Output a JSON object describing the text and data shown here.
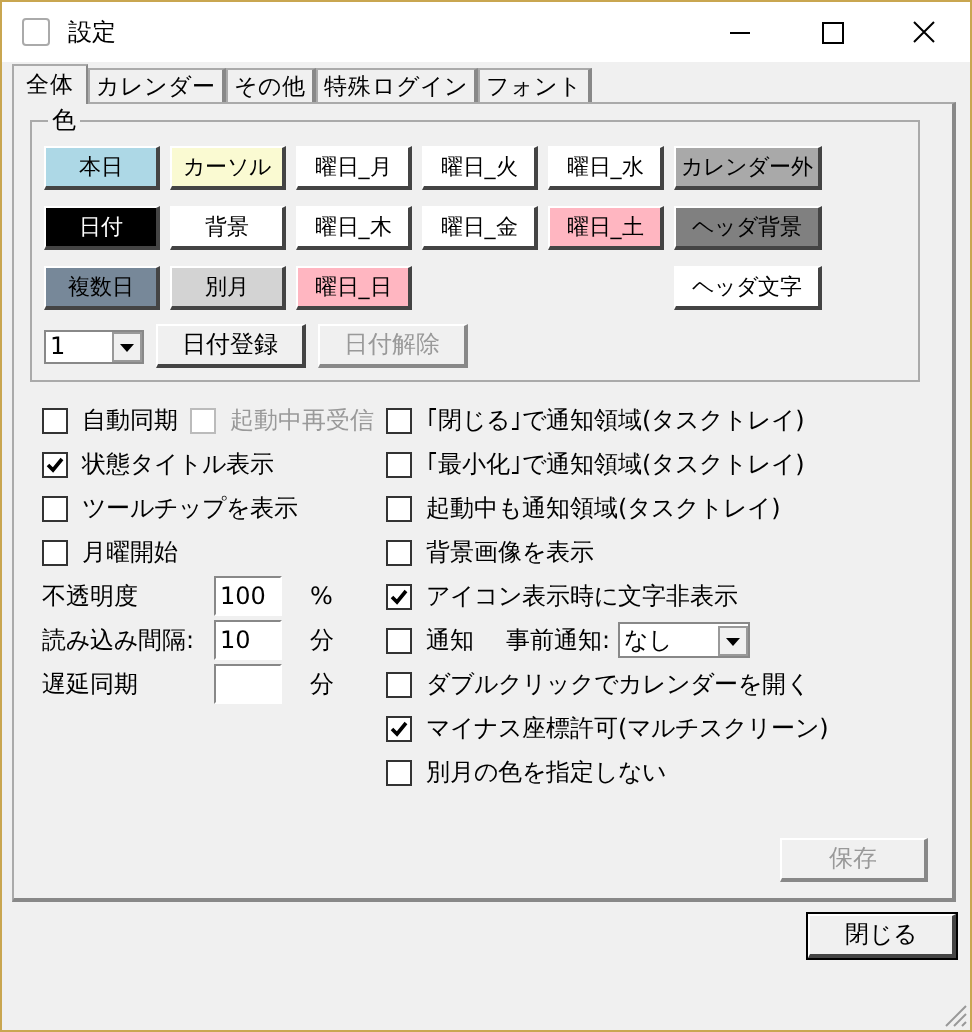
{
  "window": {
    "title": "設定"
  },
  "tabs": [
    {
      "label": "全体",
      "selected": true
    },
    {
      "label": "カレンダー",
      "selected": false
    },
    {
      "label": "その他",
      "selected": false
    },
    {
      "label": "特殊ログイン",
      "selected": false
    },
    {
      "label": "フォント",
      "selected": false
    }
  ],
  "color_group": {
    "title": "色",
    "rows": [
      [
        {
          "label": "本日",
          "color": "#add8e6"
        },
        {
          "label": "カーソル",
          "color": "#fafad2"
        },
        {
          "label": "曜日_月",
          "color": "#ffffff"
        },
        {
          "label": "曜日_火",
          "color": "#ffffff"
        },
        {
          "label": "曜日_水",
          "color": "#ffffff"
        },
        {
          "label": "カレンダー外",
          "color": "#a9a9a9"
        }
      ],
      [
        {
          "label": "日付",
          "color": "#000000"
        },
        {
          "label": "背景",
          "color": "#ffffff"
        },
        {
          "label": "曜日_木",
          "color": "#ffffff"
        },
        {
          "label": "曜日_金",
          "color": "#ffffff"
        },
        {
          "label": "曜日_土",
          "color": "#ffb6c1"
        },
        {
          "label": "ヘッダ背景",
          "color": "#808080"
        }
      ],
      [
        {
          "label": "複数日",
          "color": "#778899"
        },
        {
          "label": "別月",
          "color": "#d3d3d3"
        },
        {
          "label": "曜日_日",
          "color": "#ffb6c1"
        },
        "",
        "",
        {
          "label": "ヘッダ文字",
          "color": "#ffffff"
        }
      ]
    ],
    "combo": {
      "value": "1"
    },
    "buttons": [
      {
        "label": "日付登録",
        "disabled": false
      },
      {
        "label": "日付解除",
        "disabled": true
      }
    ]
  },
  "left_rows": [
    {
      "kind": "checkboxes",
      "items": [
        {
          "label": "自動同期",
          "checked": false,
          "disabled": false
        },
        {
          "label": "起動中再受信",
          "checked": false,
          "disabled": true
        }
      ]
    },
    {
      "kind": "checkboxes",
      "items": [
        {
          "label": "状態タイトル表示",
          "checked": true,
          "disabled": false
        }
      ]
    },
    {
      "kind": "checkboxes",
      "items": [
        {
          "label": "ツールチップを表示",
          "checked": false,
          "disabled": false
        }
      ]
    },
    {
      "kind": "checkboxes",
      "items": [
        {
          "label": "月曜開始",
          "checked": false,
          "disabled": false
        }
      ]
    },
    {
      "kind": "field",
      "label": "不透明度",
      "value": "100",
      "unit": "%"
    },
    {
      "kind": "field",
      "label": "読み込み間隔:",
      "value": "10",
      "unit": "分"
    },
    {
      "kind": "field",
      "label": "遅延同期",
      "unit": "分"
    }
  ],
  "right_rows": [
    {
      "kind": "checkbox",
      "label": "｢閉じる｣で通知領域(タスクトレイ)",
      "checked": false
    },
    {
      "kind": "checkbox",
      "label": "｢最小化｣で通知領域(タスクトレイ)",
      "checked": false
    },
    {
      "kind": "checkbox",
      "label": "起動中も通知領域(タスクトレイ)",
      "checked": false
    },
    {
      "kind": "checkbox",
      "label": "背景画像を表示",
      "checked": false
    },
    {
      "kind": "checkbox",
      "label": "アイコン表示時に文字非表示",
      "checked": true
    },
    {
      "kind": "notify",
      "label": "通知",
      "checked": false,
      "select_label": "事前通知:",
      "select_value": "なし"
    },
    {
      "kind": "checkbox",
      "label": "ダブルクリックでカレンダーを開く",
      "checked": false
    },
    {
      "kind": "checkbox",
      "label": "マイナス座標許可(マルチスクリーン)",
      "checked": true
    },
    {
      "kind": "checkbox",
      "label": "別月の色を指定しない",
      "checked": false
    }
  ],
  "save_button": {
    "label": "保存",
    "disabled": true
  },
  "close_button": {
    "label": "閉じる",
    "default": true
  }
}
